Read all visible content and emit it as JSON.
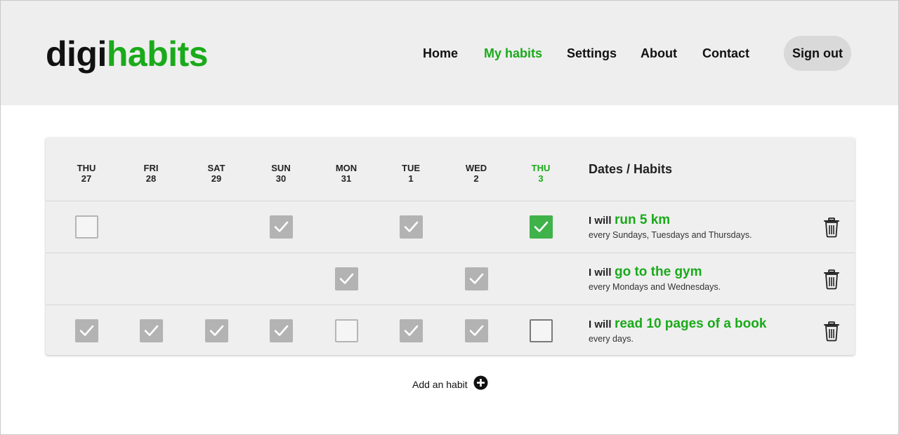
{
  "brand": {
    "part1": "digi",
    "part2": "habits"
  },
  "nav": {
    "home": "Home",
    "my_habits": "My habits",
    "settings": "Settings",
    "about": "About",
    "contact": "Contact",
    "sign_out": "Sign out"
  },
  "table": {
    "habits_header": "Dates / Habits",
    "days": [
      {
        "dow": "THU",
        "date": "27"
      },
      {
        "dow": "FRI",
        "date": "28"
      },
      {
        "dow": "SAT",
        "date": "29"
      },
      {
        "dow": "SUN",
        "date": "30"
      },
      {
        "dow": "MON",
        "date": "31"
      },
      {
        "dow": "TUE",
        "date": "1"
      },
      {
        "dow": "WED",
        "date": "2"
      },
      {
        "dow": "THU",
        "date": "3"
      }
    ],
    "today_index": 7,
    "habits": [
      {
        "prefix": "I will",
        "name": "run 5 km",
        "frequency": "every Sundays, Tuesdays and Thursdays.",
        "cells": [
          "empty",
          null,
          null,
          "checked",
          null,
          "checked",
          null,
          "checked"
        ]
      },
      {
        "prefix": "I will",
        "name": "go to the gym",
        "frequency": "every Mondays and Wednesdays.",
        "cells": [
          null,
          null,
          null,
          null,
          "checked",
          null,
          "checked",
          null
        ]
      },
      {
        "prefix": "I will",
        "name": "read 10 pages of a book",
        "frequency": "every days.",
        "cells": [
          "checked",
          "checked",
          "checked",
          "checked",
          "empty",
          "checked",
          "checked",
          "empty"
        ]
      }
    ]
  },
  "add_habit": {
    "label": "Add an habit",
    "icon": "plus-circle-icon"
  },
  "colors": {
    "accent": "#1aaa1a",
    "checked_gray": "#b3b3b3",
    "today_checked": "#3fb24a",
    "header_bg": "#eeeeee"
  }
}
